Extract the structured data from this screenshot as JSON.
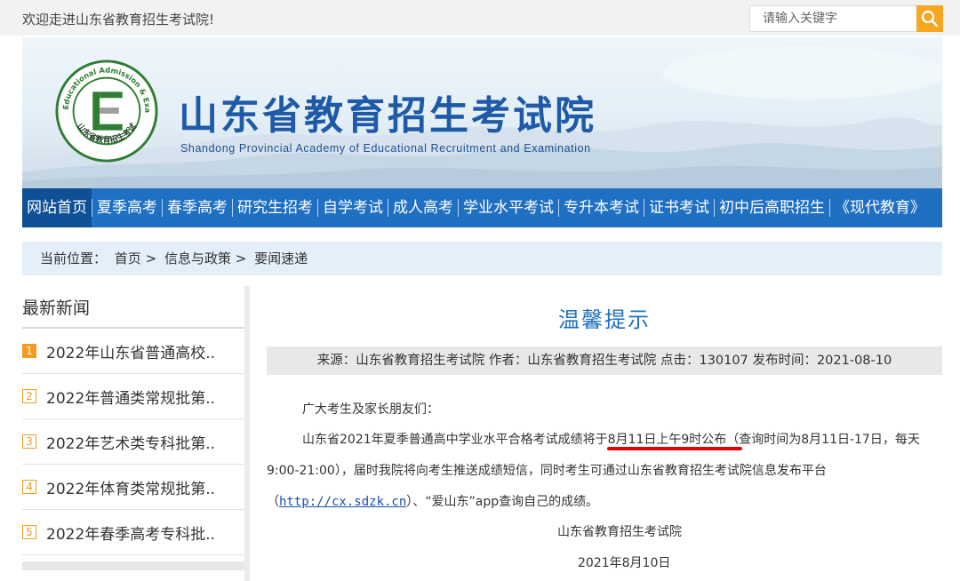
{
  "topbar": {
    "welcome": "欢迎走进山东省教育招生考试院!",
    "search_placeholder": "请输入关键字"
  },
  "banner": {
    "title_cn": "山东省教育招生考试院",
    "title_en": "Shandong Provincial Academy of Educational Recruitment and Examination",
    "logo_ring_en": "Shandong Educational Admission & Examinations",
    "logo_ring_cn": "山东省教育招生考试"
  },
  "nav": {
    "items": [
      "网站首页",
      "夏季高考",
      "春季高考",
      "研究生招考",
      "自学考试",
      "成人高考",
      "学业水平考试",
      "专升本考试",
      "证书考试",
      "初中后高职招生",
      "《现代教育》"
    ],
    "active_index": 0
  },
  "breadcrumb": {
    "prefix": "当前位置：",
    "items": [
      "首页",
      "信息与政策",
      "要闻速递"
    ],
    "separator": ">"
  },
  "sidebar": {
    "heading": "最新新闻",
    "items": [
      {
        "num": "1",
        "title": "2022年山东省普通高校.."
      },
      {
        "num": "2",
        "title": "2022年普通类常规批第.."
      },
      {
        "num": "3",
        "title": "2022年艺术类专科批第.."
      },
      {
        "num": "4",
        "title": "2022年体育类常规批第.."
      },
      {
        "num": "5",
        "title": "2022年春季高考专科批.."
      }
    ]
  },
  "article": {
    "title": "温馨提示",
    "meta": "来源：山东省教育招生考试院 作者：山东省教育招生考试院 点击：130107 发布时间：2021-08-10",
    "greeting": "广大考生及家长朋友们：",
    "para1_line1": "山东省2021年夏季普通高中学业水平合格考试成绩将于8月11日上午9时公布（查询时间为8月11日-17日，每天",
    "para1_line2": "9:00-21:00），届时我院将向考生推送成绩短信，同时考生可通过山东省教育招生考试院信息发布平台",
    "para1_line3_before": "（",
    "link": "http://cx.sdzk.cn",
    "para1_line3_after": "）、“爱山东”app查询自己的成绩。",
    "signature": "山东省教育招生考试院",
    "date": "2021年8月10日"
  },
  "colors": {
    "nav_bg": "#1f6fc2",
    "nav_active": "#0f4f95",
    "accent_orange": "#f5a623",
    "title_blue": "#1f6fc2",
    "highlight_underline": "#e60000"
  }
}
